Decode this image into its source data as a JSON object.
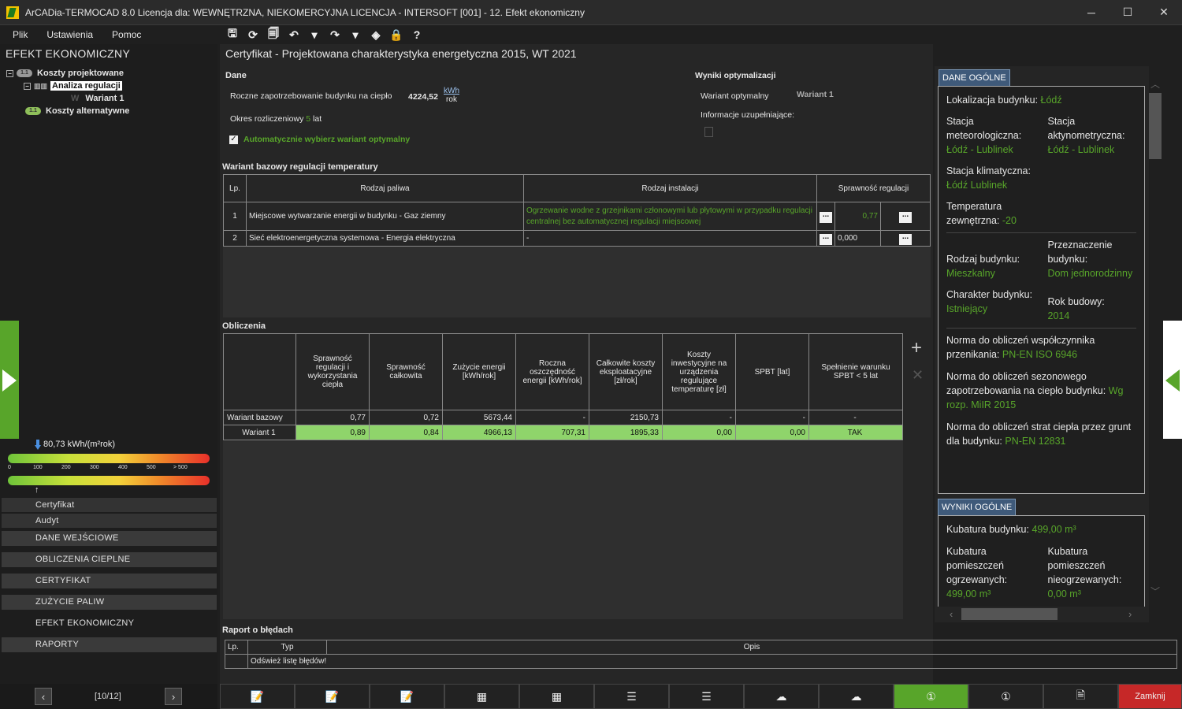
{
  "window": {
    "title": "ArCADia-TERMOCAD 8.0 Licencja dla: WEWNĘTRZNA, NIEKOMERCYJNA LICENCJA - INTERSOFT [001] - 12. Efekt ekonomiczny",
    "minimize": "─",
    "maximize": "☐",
    "close": "✕"
  },
  "menu": {
    "file": "Plik",
    "settings": "Ustawienia",
    "help": "Pomoc"
  },
  "toolbar": {
    "save": "🖫",
    "refresh": "⟳",
    "saveas": "🗐",
    "undo": "↶",
    "undo_dd": "▾",
    "redo": "↷",
    "redo_dd": "▾",
    "layers": "◈",
    "lock": "🔒",
    "helpq": "?"
  },
  "left": {
    "title": "EFEKT EKONOMICZNY",
    "tree": {
      "projected": "Koszty projektowane",
      "analysis": "Analiza regulacji",
      "variant1": "Wariant 1",
      "alternative": "Koszty alternatywne",
      "badge": "1.1"
    },
    "energy": {
      "value": "80,73 kWh/(m²rok)",
      "ticks": [
        "0",
        "100",
        "200",
        "300",
        "400",
        "500",
        "> 500"
      ],
      "fraction": 0.16
    },
    "nav": {
      "cert": "Certyfikat",
      "audit": "Audyt",
      "input": "DANE WEJŚCIOWE",
      "heat": "OBLICZENIA CIEPLNE",
      "certificate": "CERTYFIKAT",
      "fuel": "ZUŻYCIE PALIW",
      "eco": "EFEKT EKONOMICZNY",
      "reports": "RAPORTY"
    },
    "pager": {
      "prev": "‹",
      "next": "›",
      "indicator": "[10/12]"
    }
  },
  "main": {
    "title": "Certyfikat - Projektowana charakterystyka energetyczna 2015, WT 2021",
    "dane": {
      "header": "Dane",
      "demand_label": "Roczne zapotrzebowanie budynku na ciepło",
      "demand_value": "4224,52",
      "unit_top": "kWh",
      "unit_bottom": "rok",
      "period_label": "Okres rozliczeniowy",
      "period_value": "5",
      "period_unit": "lat",
      "auto_label": "Automatycznie wybierz wariant optymalny"
    },
    "optim": {
      "header": "Wyniki optymalizacji",
      "opt_label": "Wariant optymalny",
      "opt_value": "Wariant 1",
      "info_label": "Informacje uzupełniające:"
    },
    "base": {
      "header": "Wariant bazowy regulacji temperatury",
      "cols": [
        "Lp.",
        "Rodzaj paliwa",
        "Rodzaj instalacji",
        "Sprawność regulacji"
      ],
      "rows": [
        {
          "lp": "1",
          "fuel": "Miejscowe wytwarzanie energii w budynku - Gaz ziemny",
          "install": "Ogrzewanie wodne z grzejnikami członowymi lub płytowymi w przypadku regulacji centralnej bez automatycznej regulacji miejscowej",
          "eff": "0,77"
        },
        {
          "lp": "2",
          "fuel": "Sieć elektroenergetyczna systemowa - Energia elektryczna",
          "install": "-",
          "eff": "0,000"
        }
      ],
      "dots": "..."
    },
    "calc": {
      "header": "Obliczenia",
      "cols": [
        "Sprawność regulacji i wykorzystania ciepła",
        "Sprawność całkowita",
        "Zużycie energii [kWh/rok]",
        "Roczna oszczędność energii [kWh/rok]",
        "Całkowite koszty eksploatacyjne [zł/rok]",
        "Koszty inwestycyjne na urządzenia regulujące temperaturę [zł]",
        "SPBT [lat]",
        "Spełnienie warunku SPBT < 5 lat"
      ],
      "rows": [
        {
          "name": "Wariant bazowy",
          "v": [
            "0,77",
            "0,72",
            "5673,44",
            "-",
            "2150,73",
            "-",
            "-",
            "-"
          ]
        },
        {
          "name": "Wariant 1",
          "v": [
            "0,89",
            "0,84",
            "4966,13",
            "707,31",
            "1895,33",
            "0,00",
            "0,00",
            "TAK"
          ]
        }
      ],
      "add": "+",
      "remove": "✕"
    },
    "errors": {
      "header": "Raport o błędach",
      "cols": [
        "Lp.",
        "Typ",
        "Opis"
      ],
      "row": "Odśwież listę błędów!"
    }
  },
  "right": {
    "general_header": "DANE OGÓLNE",
    "location_label": "Lokalizacja budynku:",
    "location": "Łódź",
    "meteo_label": "Stacja meteorologiczna:",
    "meteo": "Łódź - Lublinek",
    "actino_label": "Stacja aktynometryczna:",
    "actino": "Łódź - Lublinek",
    "climate_label": "Stacja klimatyczna:",
    "climate": "Łódź Lublinek",
    "temp_label": "Temperatura zewnętrzna:",
    "temp": "-20",
    "type_label": "Rodzaj budynku:",
    "type": "Mieszkalny",
    "purpose_label": "Przeznaczenie budynku:",
    "purpose": "Dom jednorodzinny",
    "character_label": "Charakter budynku:",
    "character": "Istniejący",
    "year_label": "Rok budowy:",
    "year": "2014",
    "norm1_label": "Norma do obliczeń współczynnika przenikania:",
    "norm1": "PN-EN ISO 6946",
    "norm2_label": "Norma do obliczeń sezonowego zapotrzebowania na ciepło budynku:",
    "norm2": "Wg rozp. MiIR 2015",
    "norm3_label": "Norma do obliczeń strat ciepła przez grunt dla budynku:",
    "norm3": "PN-EN 12831",
    "results_header": "WYNIKI OGÓLNE",
    "volume_label": "Kubatura budynku:",
    "volume": "499,00 m³",
    "heated_label": "Kubatura pomieszczeń ogrzewanych:",
    "heated": "499,00 m³",
    "unheated_label": "Kubatura pomieszczeń nieogrzewanych:",
    "unheated": "0,00 m³"
  },
  "bottom": {
    "icons": [
      "📝",
      "📝",
      "📝",
      "▦",
      "▦",
      "☰",
      "☰",
      "☁",
      "☁",
      "①",
      "①",
      "🗎"
    ],
    "close": "Zamknij"
  }
}
